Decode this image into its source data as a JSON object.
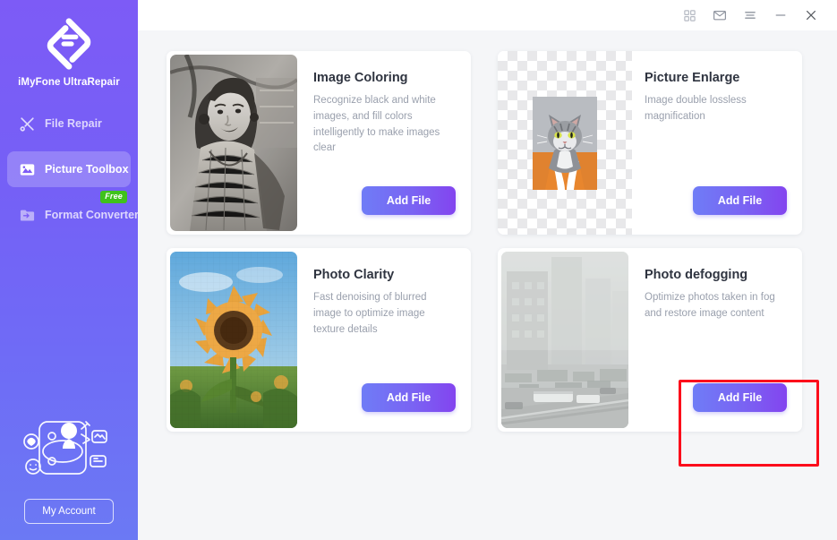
{
  "app": {
    "brand_name": "iMyFone UltraRepair",
    "logo_icon": "diamond-f-logo-icon"
  },
  "sidebar": {
    "items": [
      {
        "label": "File Repair",
        "icon": "wrench-screwdriver-icon",
        "active": false,
        "badge": null
      },
      {
        "label": "Picture Toolbox",
        "icon": "image-picture-icon",
        "active": true,
        "badge": null
      },
      {
        "label": "Format Converter",
        "icon": "folder-convert-icon",
        "active": false,
        "badge": "Free"
      }
    ],
    "account_button_label": "My Account",
    "illustration_icon": "account-illustration-icon"
  },
  "titlebar": {
    "buttons": [
      {
        "name": "grid-apps-icon",
        "label": ""
      },
      {
        "name": "mail-envelope-icon",
        "label": ""
      },
      {
        "name": "hamburger-menu-icon",
        "label": ""
      },
      {
        "name": "minimize-icon",
        "label": ""
      },
      {
        "name": "close-icon",
        "label": ""
      }
    ]
  },
  "main": {
    "cards": [
      {
        "title": "Image Coloring",
        "description": "Recognize black and white images, and fill colors intelligently to make images clear",
        "button_label": "Add File",
        "thumb_kind": "bw-portrait-woman",
        "highlighted": false
      },
      {
        "title": "Picture Enlarge",
        "description": "Image double lossless magnification",
        "button_label": "Add File",
        "thumb_kind": "cat-on-checkerboard",
        "highlighted": false
      },
      {
        "title": "Photo Clarity",
        "description": "Fast denoising of blurred image to optimize image texture details",
        "button_label": "Add File",
        "thumb_kind": "pixelated-sunflower",
        "highlighted": false
      },
      {
        "title": "Photo defogging",
        "description": "Optimize photos taken in fog and restore image content",
        "button_label": "Add File",
        "thumb_kind": "foggy-cityscape",
        "highlighted": true
      }
    ]
  },
  "annotation": {
    "highlight_color": "#fc0d1b",
    "target": "Add File button of Photo defogging card"
  },
  "colors": {
    "sidebar_top": "#7d5bf6",
    "sidebar_bottom": "#6b79f4",
    "accent_button_start": "#6f7cf6",
    "accent_button_end": "#8344ef",
    "badge_green": "#3fc21c",
    "content_bg": "#f5f6f8"
  }
}
